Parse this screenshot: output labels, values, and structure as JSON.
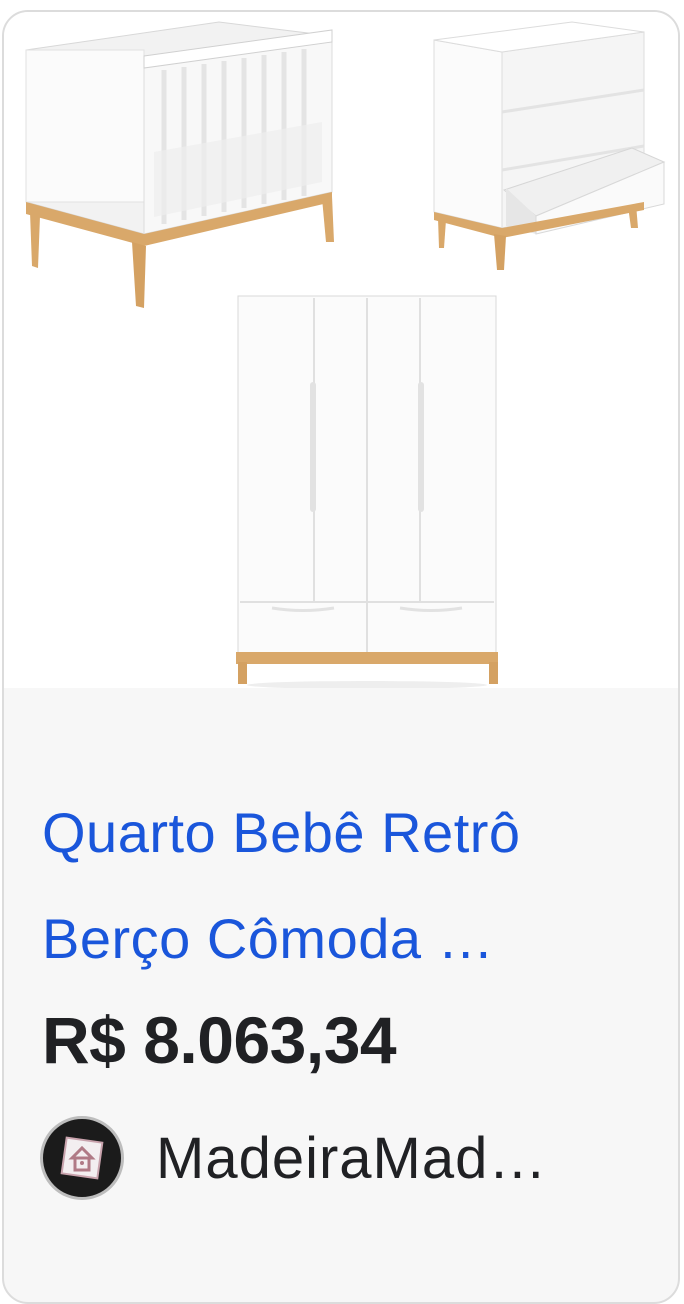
{
  "product": {
    "title_line1": "Quarto Bebê Retrô",
    "title_line2": "Berço Cômoda …",
    "price": "R$ 8.063,34"
  },
  "seller": {
    "name": "MadeiraMad…",
    "logo_icon": "house-logo-icon"
  },
  "colors": {
    "title": "#1a56db",
    "price": "#202124",
    "wood": "#d9a86a",
    "card_bg": "#f7f7f7"
  }
}
